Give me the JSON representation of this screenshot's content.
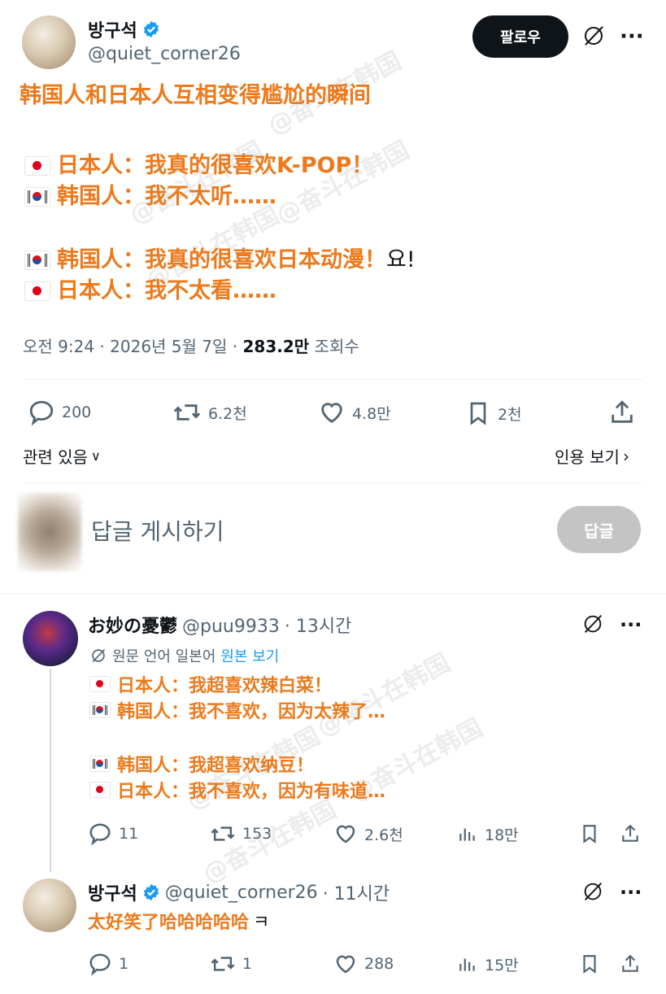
{
  "post": {
    "author_name": "방구석",
    "handle": "@quiet_corner26",
    "follow_label": "팔로우",
    "title": "韩国人和日本人互相变得尴尬的瞬间",
    "lines": [
      {
        "flag": "jp",
        "text": "日本人：我真的很喜欢K-POP！",
        "suffix": ""
      },
      {
        "flag": "kr",
        "text": "韩国人：我不太听……",
        "suffix": ""
      },
      {
        "flag": "kr",
        "text": "韩国人：我真的很喜欢日本动漫！",
        "suffix": "요!"
      },
      {
        "flag": "jp",
        "text": "日本人：我不太看……",
        "suffix": ""
      }
    ],
    "time": "오전 9:24 · 2026년 5월 7일 ·",
    "views_value": "283.2만",
    "views_label": "조회수",
    "stats": {
      "replies": "200",
      "reposts": "6.2천",
      "likes": "4.8만",
      "bookmarks": "2천"
    },
    "related_label": "관련 있음",
    "quote_label": "인용 보기"
  },
  "composer": {
    "placeholder": "답글 게시하기",
    "button": "답글"
  },
  "reply1": {
    "author_name": "お妙の憂鬱",
    "handle": "@puu9933",
    "time": "· 13시간",
    "translation_label": "원문 언어 일본어",
    "translation_link": "원본 보기",
    "lines": [
      {
        "flag": "jp",
        "text": "日本人：我超喜欢辣白菜！",
        "suffix": ""
      },
      {
        "flag": "kr",
        "text": "韩国人：我不喜欢，因为太辣了…",
        "suffix": ""
      },
      {
        "flag": "kr",
        "text": "韩国人：我超喜欢纳豆！",
        "suffix": ""
      },
      {
        "flag": "jp",
        "text": "日本人：我不喜欢，因为有味道…",
        "suffix": ""
      }
    ],
    "stats": {
      "replies": "11",
      "reposts": "153",
      "likes": "2.6천",
      "views": "18만"
    }
  },
  "reply2": {
    "author_name": "방구석",
    "handle": "@quiet_corner26",
    "time": "· 11시간",
    "text": "太好笑了哈哈哈哈哈",
    "suffix": "ㅋ",
    "stats": {
      "replies": "1",
      "reposts": "1",
      "likes": "288",
      "views": "15만"
    }
  },
  "watermark": "@奋斗在韩国"
}
